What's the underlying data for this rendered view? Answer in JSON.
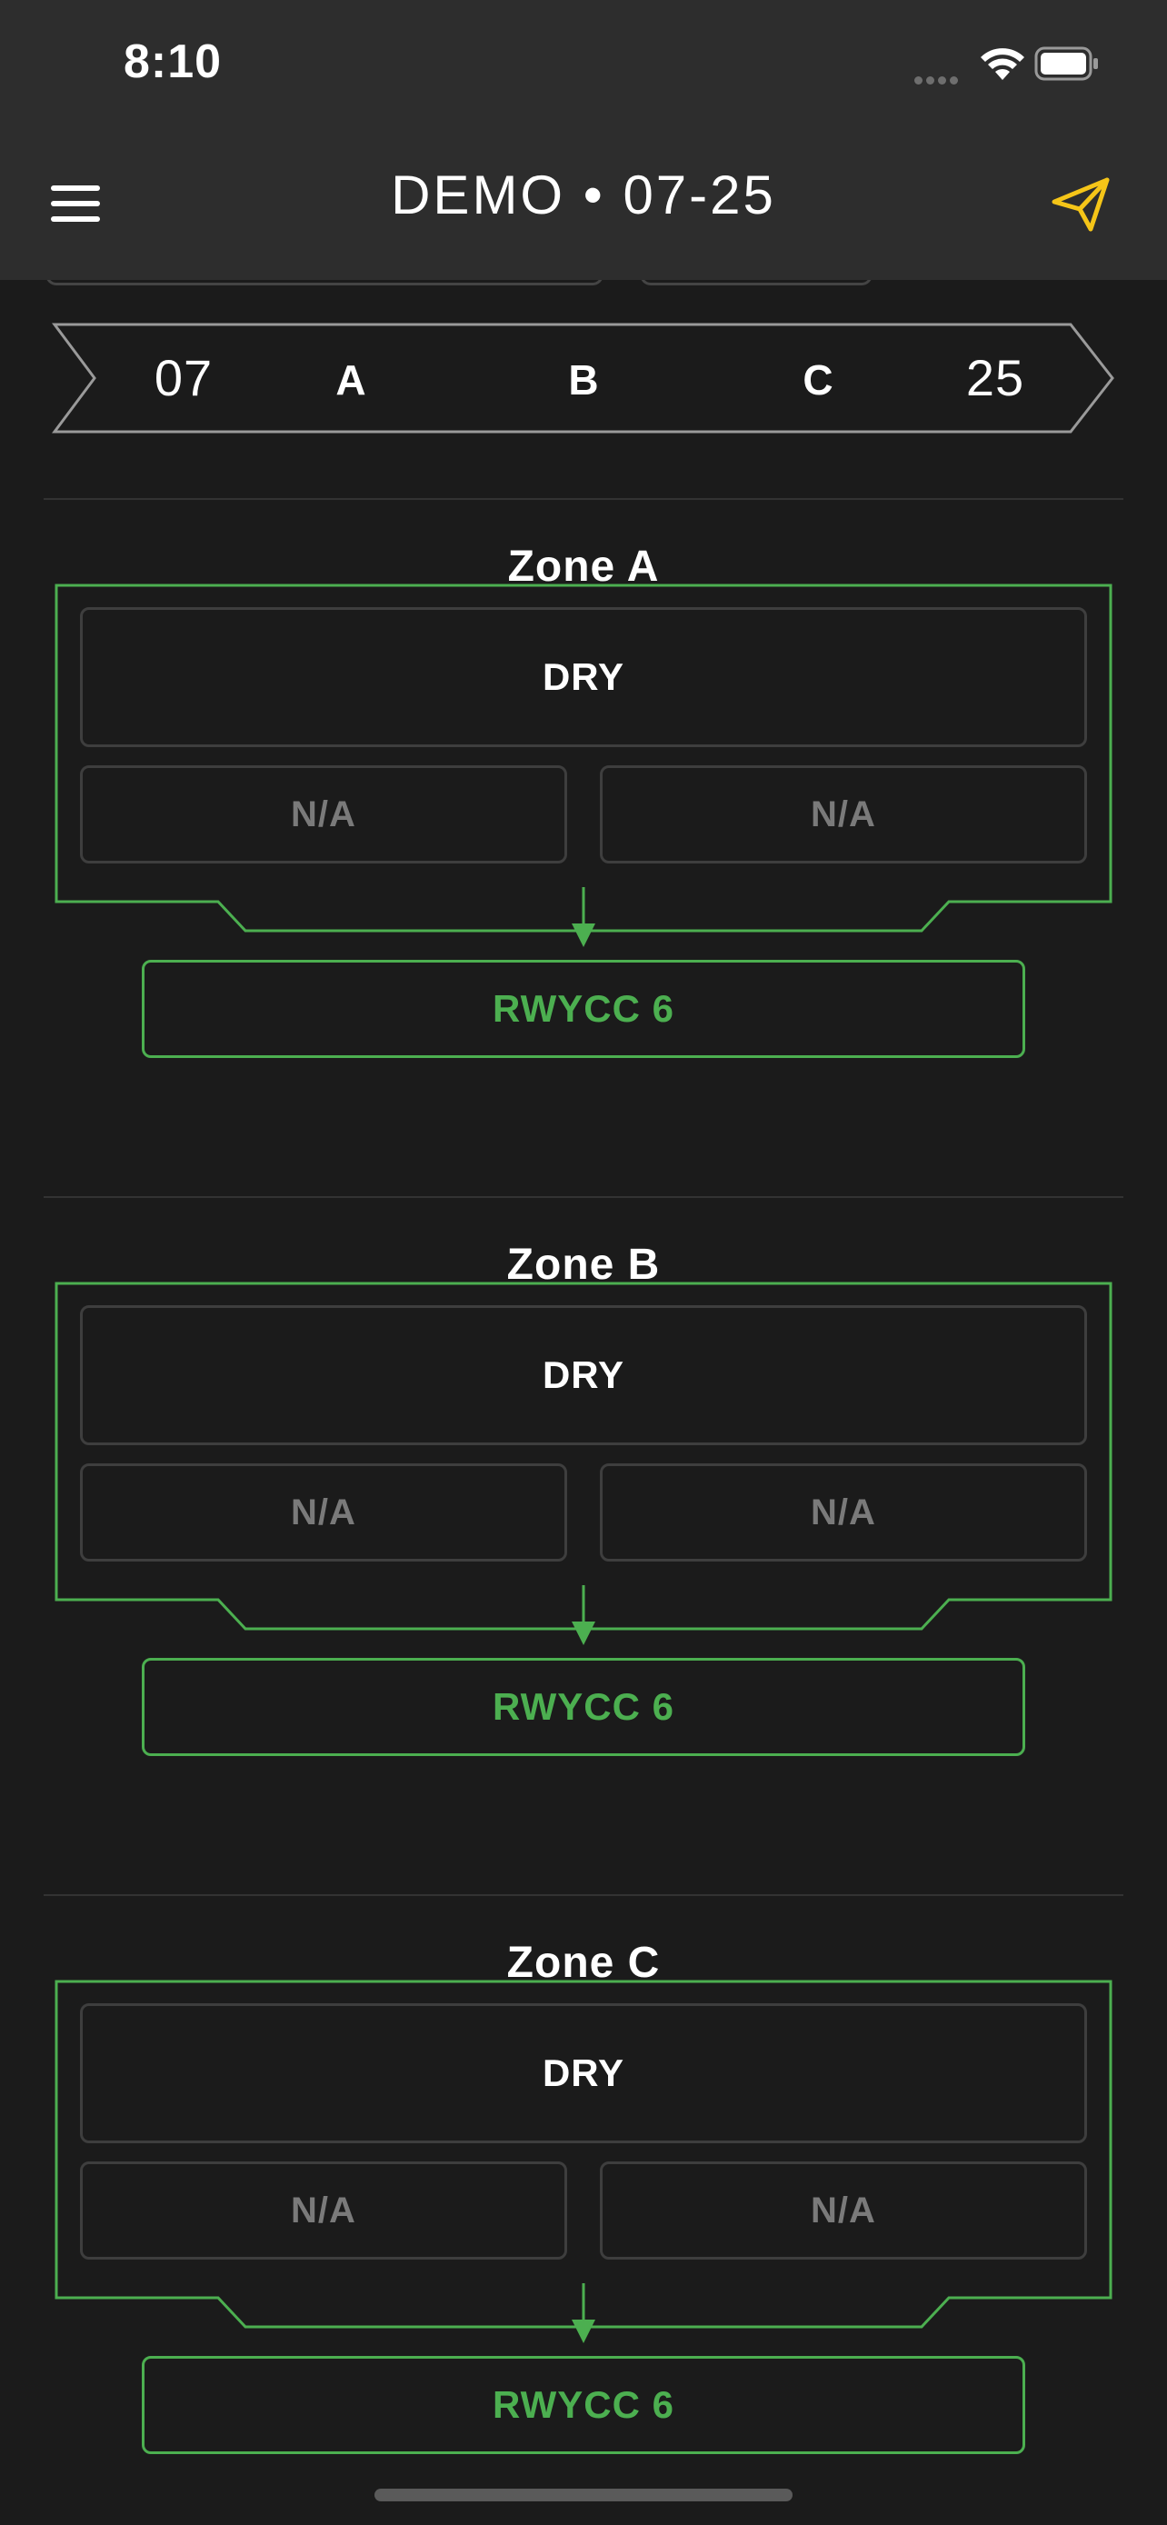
{
  "status_bar": {
    "time": "8:10"
  },
  "nav": {
    "title": "DEMO • 07-25",
    "menu_icon": "hamburger-menu-icon",
    "send_icon": "paper-plane-icon"
  },
  "runway": {
    "end_left": "07",
    "end_right": "25",
    "zone_labels": [
      "A",
      "B",
      "C"
    ]
  },
  "zones": [
    {
      "title": "Zone A",
      "main_condition": "DRY",
      "sub_left": "N/A",
      "sub_right": "N/A",
      "rwycc": "RWYCC 6"
    },
    {
      "title": "Zone B",
      "main_condition": "DRY",
      "sub_left": "N/A",
      "sub_right": "N/A",
      "rwycc": "RWYCC 6"
    },
    {
      "title": "Zone C",
      "main_condition": "DRY",
      "sub_left": "N/A",
      "sub_right": "N/A",
      "rwycc": "RWYCC 6"
    }
  ],
  "colors": {
    "background": "#1b1b1b",
    "header": "#2d2d2d",
    "accent_green": "#4caf50",
    "send_yellow": "#f5c518",
    "muted_text": "#7a7a7a"
  }
}
